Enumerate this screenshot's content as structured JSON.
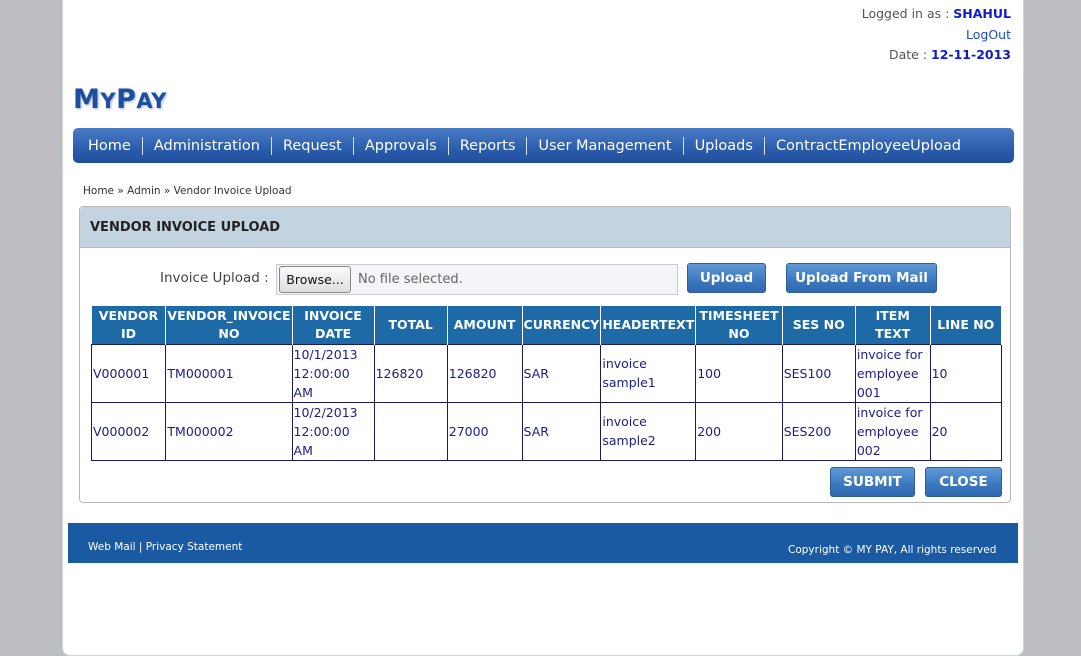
{
  "header": {
    "logged_in_label": "Logged in as : ",
    "user_name": "SHAHUL",
    "logout": "LogOut",
    "date_label": "Date : ",
    "date_value": "12-11-2013",
    "logo_first": "M",
    "logo_rest1": "Y",
    "logo_second": "P",
    "logo_rest2": "AY"
  },
  "nav": {
    "items": [
      "Home",
      "Administration",
      "Request",
      "Approvals",
      "Reports",
      "User Management",
      "Uploads",
      "ContractEmployeeUpload"
    ]
  },
  "breadcrumb": "Home » Admin » Vendor Invoice Upload",
  "panel": {
    "title": "VENDOR INVOICE UPLOAD",
    "upload_label": "Invoice Upload :",
    "browse_label": "Browse...",
    "file_text": "No file selected.",
    "upload_button": "Upload",
    "upload_mail_button": "Upload From Mail",
    "submit_button": "SUBMIT",
    "close_button": "CLOSE"
  },
  "table": {
    "headers": [
      "VENDOR ID",
      "VENDOR_INVOICE NO",
      "INVOICE DATE",
      "TOTAL",
      "AMOUNT",
      "CURRENCY",
      "HEADERTEXT",
      "TIMESHEET NO",
      "SES NO",
      "ITEM TEXT",
      "LINE NO"
    ],
    "rows": [
      [
        "V000001",
        "TM000001",
        "10/1/2013 12:00:00 AM",
        "126820",
        "126820",
        "SAR",
        "invoice sample1",
        "100",
        "SES100",
        "invoice for employee 001",
        "10"
      ],
      [
        "V000002",
        "TM000002",
        "10/2/2013 12:00:00 AM",
        "",
        "27000",
        "SAR",
        "invoice sample2",
        "200",
        "SES200",
        "invoice for employee 002",
        "20"
      ]
    ]
  },
  "footer": {
    "web_mail": "Web Mail",
    "separator": " | ",
    "privacy": "Privacy Statement",
    "copyright": "Copyright © MY PAY, All rights reserved"
  }
}
